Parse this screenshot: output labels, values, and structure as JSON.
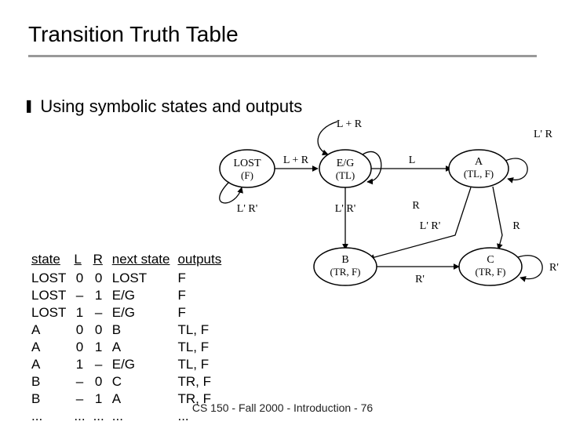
{
  "title": "Transition Truth Table",
  "bullet": {
    "text": "Using symbolic states and outputs"
  },
  "diagram": {
    "states": {
      "lost": {
        "line1": "LOST",
        "line2": "(F)"
      },
      "eg": {
        "line1": "E/G",
        "line2": "(TL)"
      },
      "a": {
        "line1": "A",
        "line2": "(TL, F)"
      },
      "b": {
        "line1": "B",
        "line2": "(TR, F)"
      },
      "c": {
        "line1": "C",
        "line2": "(TR, F)"
      }
    },
    "edges": {
      "lost_self": "L + R",
      "lost_to_eg": "L' R'",
      "eg_incoming_top": "L + R",
      "eg_to_a": "L",
      "a_self": "L' R",
      "eg_to_b": "L' R'",
      "b_from_a": "R",
      "a_to_b_lrr": "L' R'",
      "b_to_c_rprime": "R'",
      "c_to_a_R": "R",
      "c_self_rprime": "R'"
    }
  },
  "table": {
    "headers": [
      "state",
      "L",
      "R",
      "next state",
      "outputs"
    ],
    "rows": [
      [
        "LOST",
        "0",
        "0",
        "LOST",
        "F"
      ],
      [
        "LOST",
        "–",
        "1",
        "E/G",
        "F"
      ],
      [
        "LOST",
        "1",
        "–",
        "E/G",
        "F"
      ],
      [
        "A",
        "0",
        "0",
        "B",
        "TL, F"
      ],
      [
        "A",
        "0",
        "1",
        "A",
        "TL, F"
      ],
      [
        "A",
        "1",
        "–",
        "E/G",
        "TL, F"
      ],
      [
        "B",
        "–",
        "0",
        "C",
        "TR, F"
      ],
      [
        "B",
        "–",
        "1",
        "A",
        "TR, F"
      ],
      [
        "...",
        "...",
        "...",
        "...",
        "..."
      ]
    ]
  },
  "footer": "CS 150 - Fall 2000 - Introduction - 76"
}
